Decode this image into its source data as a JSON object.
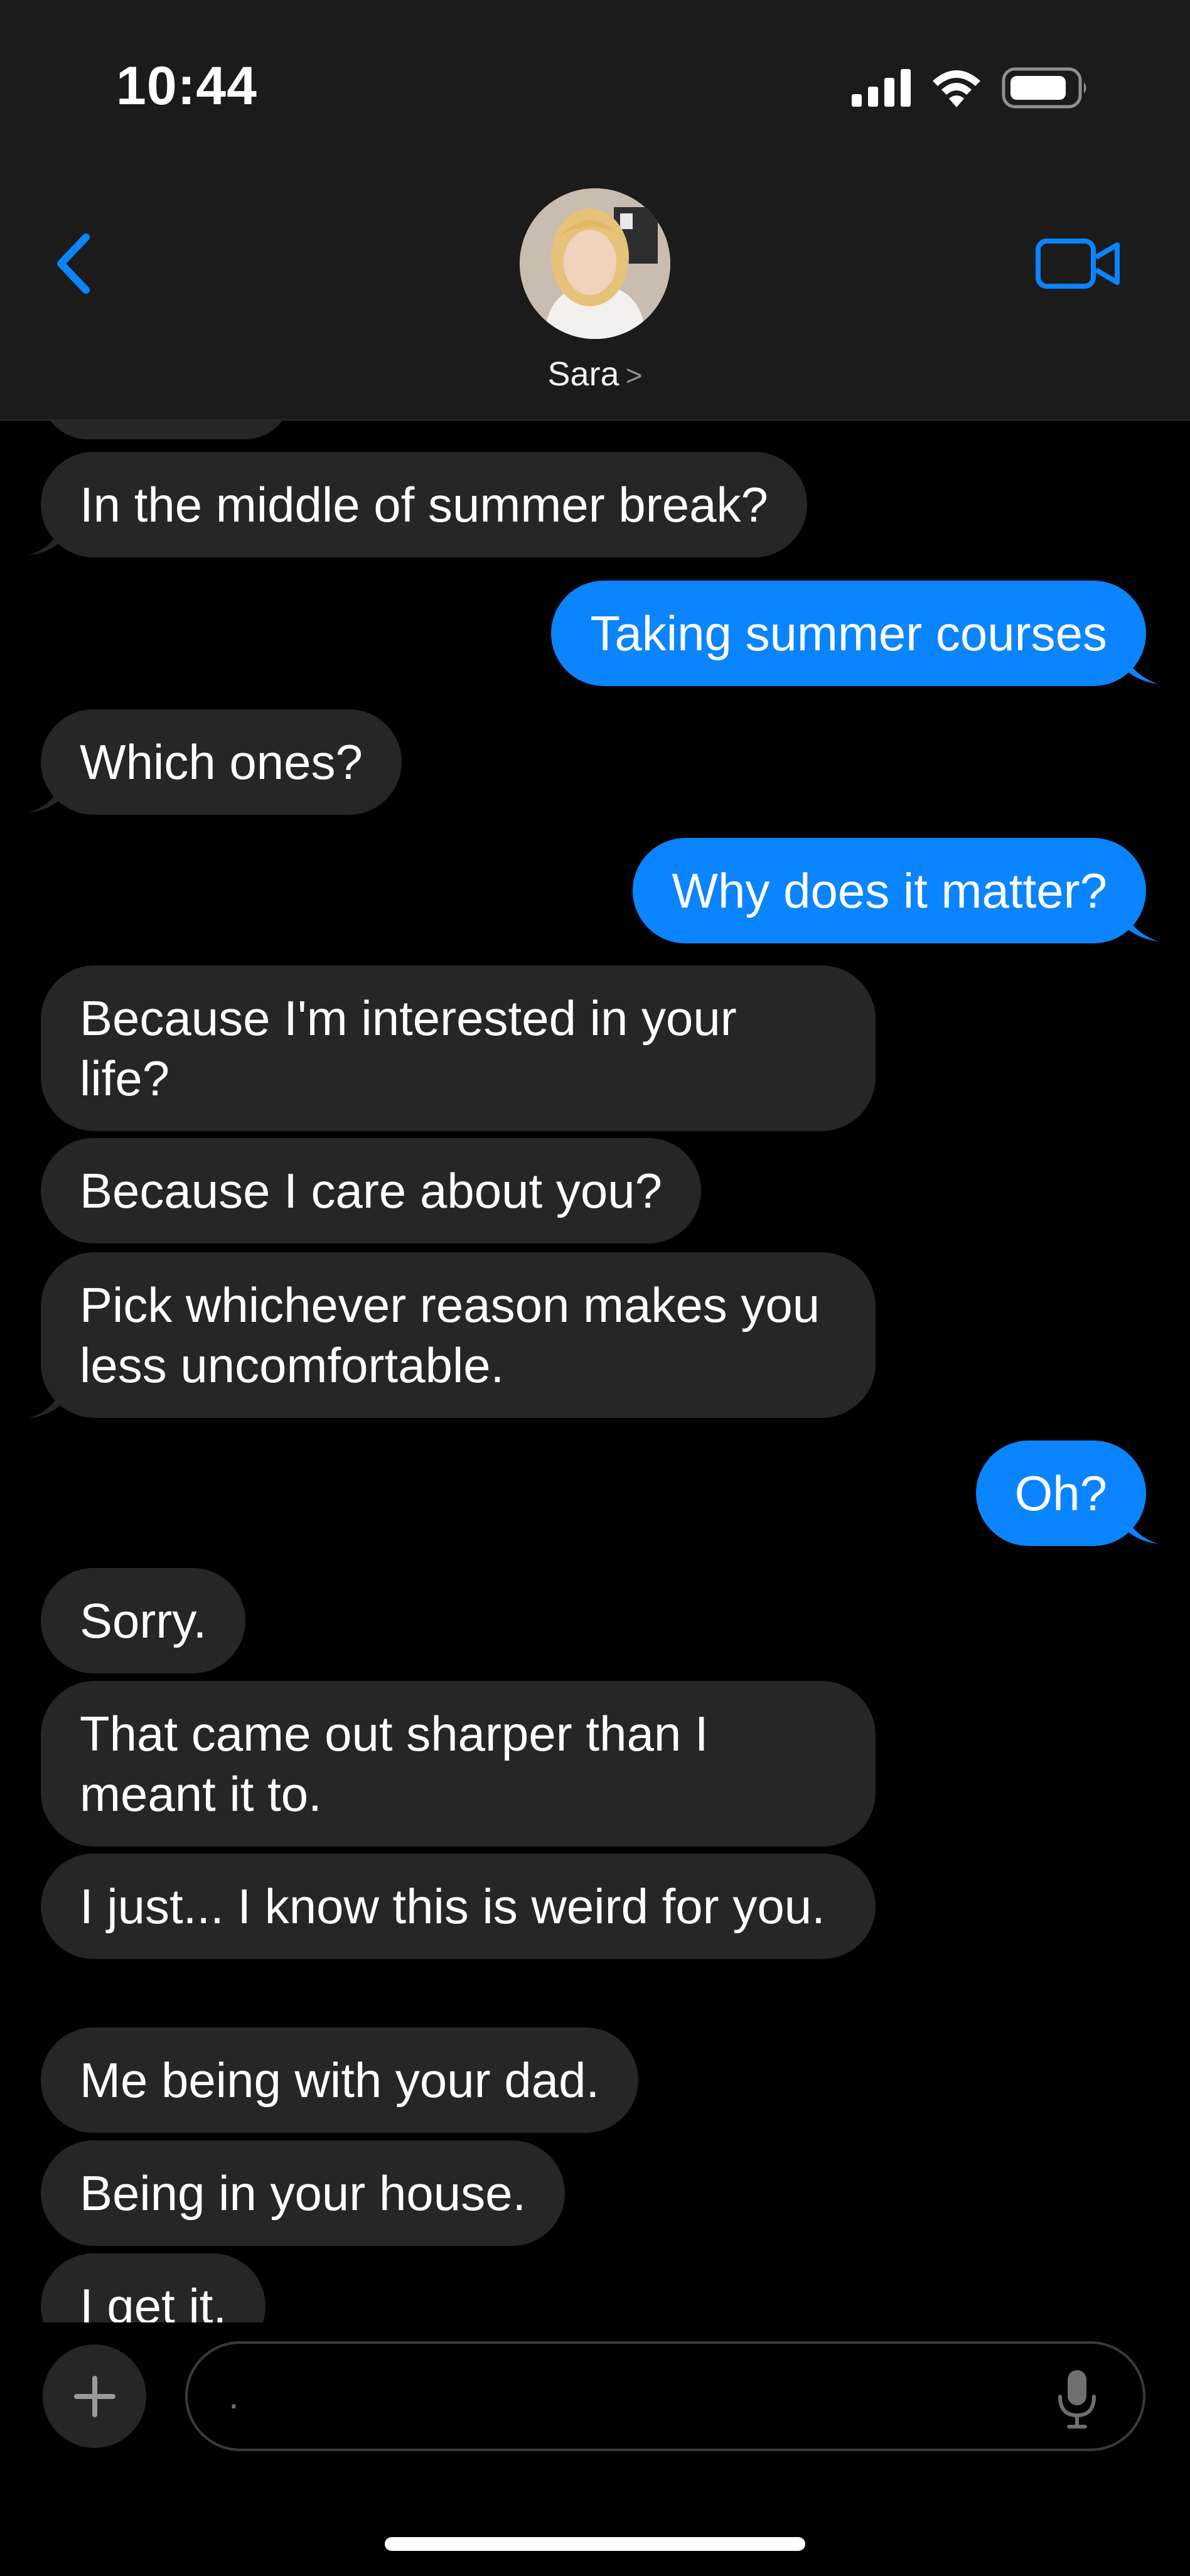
{
  "status_bar": {
    "time": "10:44"
  },
  "header": {
    "contact_name": "Sara",
    "contact_chevron": ">"
  },
  "messages": [
    {
      "from": "in",
      "text": ""
    },
    {
      "from": "in",
      "text": "In the middle of summer break?"
    },
    {
      "from": "out",
      "text": "Taking summer courses"
    },
    {
      "from": "in",
      "text": "Which ones?"
    },
    {
      "from": "out",
      "text": "Why does it matter?"
    },
    {
      "from": "in",
      "text": "Because I'm interested in your life?"
    },
    {
      "from": "in",
      "text": "Because I care about you?"
    },
    {
      "from": "in",
      "text": "Pick whichever reason makes you less uncomfortable."
    },
    {
      "from": "out",
      "text": "Oh?"
    },
    {
      "from": "in",
      "text": "Sorry."
    },
    {
      "from": "in",
      "text": "That came out sharper than I meant it to."
    },
    {
      "from": "in",
      "text": "I just... I know this is weird for you."
    },
    {
      "from": "in",
      "text": "Me being with your dad."
    },
    {
      "from": "in",
      "text": "Being in your house."
    },
    {
      "from": "in",
      "text": "I get it."
    }
  ],
  "input": {
    "value": "."
  },
  "colors": {
    "incoming": "#262628",
    "outgoing": "#0a84ff",
    "accent": "#0a84ff",
    "background": "#000000"
  }
}
